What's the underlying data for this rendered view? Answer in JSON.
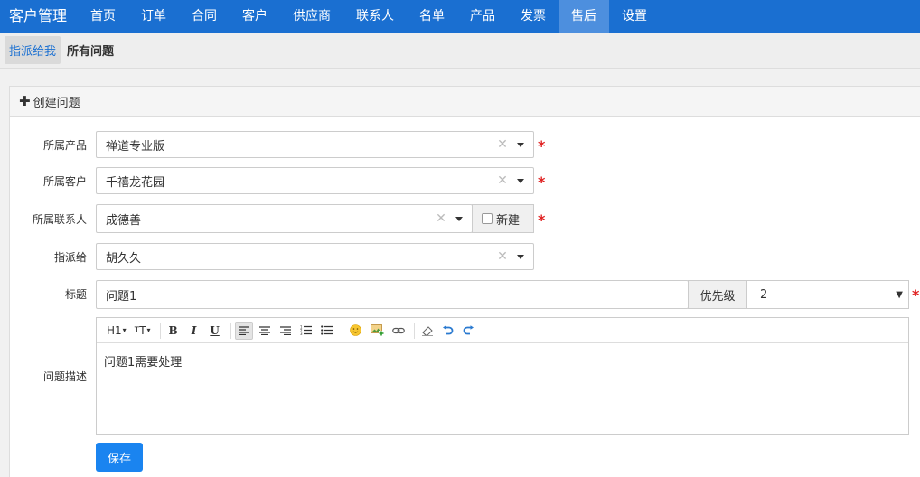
{
  "app": {
    "title": "客户管理"
  },
  "nav": {
    "items": [
      {
        "label": "首页"
      },
      {
        "label": "订单"
      },
      {
        "label": "合同"
      },
      {
        "label": "客户"
      },
      {
        "label": "供应商"
      },
      {
        "label": "联系人"
      },
      {
        "label": "名单"
      },
      {
        "label": "产品"
      },
      {
        "label": "发票"
      },
      {
        "label": "售后",
        "active": true
      },
      {
        "label": "设置"
      }
    ]
  },
  "subnav": {
    "assigned_to_me": "指派给我",
    "all_issues": "所有问题"
  },
  "panel": {
    "title": "创建问题"
  },
  "form": {
    "product": {
      "label": "所属产品",
      "value": "禅道专业版"
    },
    "customer": {
      "label": "所属客户",
      "value": "千禧龙花园"
    },
    "contact": {
      "label": "所属联系人",
      "value": "成德善",
      "new_label": "新建"
    },
    "assignee": {
      "label": "指派给",
      "value": "胡久久"
    },
    "title": {
      "label": "标题",
      "value": "问题1"
    },
    "priority": {
      "label": "优先级",
      "value": "2"
    },
    "description": {
      "label": "问题描述",
      "value": "问题1需要处理"
    },
    "required_mark": "*",
    "save_label": "保存"
  },
  "toolbar": {
    "heading": "H1",
    "font_size": "TT"
  },
  "colors": {
    "nav_bg": "#1a6fd1",
    "nav_active": "#4d8fde",
    "save_btn": "#1a84f0",
    "required": "#e02020"
  }
}
